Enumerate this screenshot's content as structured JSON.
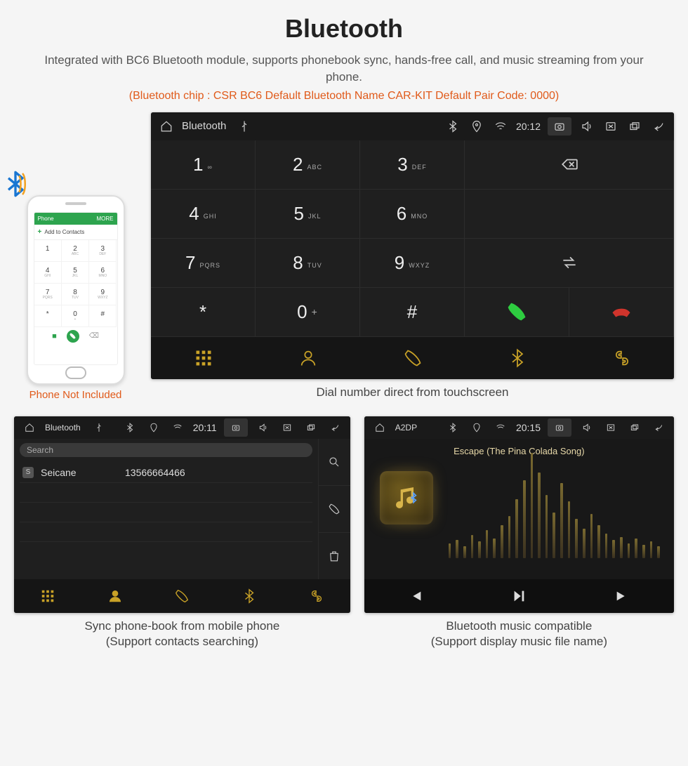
{
  "header": {
    "title": "Bluetooth",
    "description": "Integrated with BC6 Bluetooth module, supports phonebook sync, hands-free call, and music streaming from your phone.",
    "note": "(Bluetooth chip : CSR BC6    Default Bluetooth Name CAR-KIT    Default Pair Code: 0000)"
  },
  "phone_mock": {
    "top_left": "Phone",
    "top_right": "MORE",
    "add_label": "Add to Contacts",
    "keys": [
      {
        "n": "1",
        "s": ""
      },
      {
        "n": "2",
        "s": "ABC"
      },
      {
        "n": "3",
        "s": "DEF"
      },
      {
        "n": "4",
        "s": "GHI"
      },
      {
        "n": "5",
        "s": "JKL"
      },
      {
        "n": "6",
        "s": "MNO"
      },
      {
        "n": "7",
        "s": "PQRS"
      },
      {
        "n": "8",
        "s": "TUV"
      },
      {
        "n": "9",
        "s": "WXYZ"
      },
      {
        "n": "*",
        "s": ""
      },
      {
        "n": "0",
        "s": "+"
      },
      {
        "n": "#",
        "s": ""
      }
    ],
    "caption": "Phone Not Included"
  },
  "dialer": {
    "status": {
      "title": "Bluetooth",
      "time": "20:12"
    },
    "keys": [
      {
        "n": "1",
        "s": "∞"
      },
      {
        "n": "2",
        "s": "ABC"
      },
      {
        "n": "3",
        "s": "DEF"
      },
      {
        "n": "4",
        "s": "GHI"
      },
      {
        "n": "5",
        "s": "JKL"
      },
      {
        "n": "6",
        "s": "MNO"
      },
      {
        "n": "7",
        "s": "PQRS"
      },
      {
        "n": "8",
        "s": "TUV"
      },
      {
        "n": "9",
        "s": "WXYZ"
      },
      {
        "n": "*",
        "s": ""
      },
      {
        "n": "0",
        "s": "+"
      },
      {
        "n": "#",
        "s": ""
      }
    ],
    "caption": "Dial number direct from touchscreen"
  },
  "contacts": {
    "status": {
      "title": "Bluetooth",
      "time": "20:11"
    },
    "search_placeholder": "Search",
    "rows": [
      {
        "initial": "S",
        "name": "Seicane",
        "number": "13566664466"
      }
    ],
    "caption_line1": "Sync phone-book from mobile phone",
    "caption_line2": "(Support contacts searching)"
  },
  "a2dp": {
    "status": {
      "title": "A2DP",
      "time": "20:15"
    },
    "track": "Escape (The Pina Colada Song)",
    "viz_heights": [
      18,
      22,
      14,
      28,
      20,
      34,
      24,
      40,
      52,
      72,
      96,
      130,
      105,
      78,
      56,
      92,
      70,
      48,
      36,
      54,
      40,
      30,
      22,
      26,
      18,
      24,
      16,
      20,
      14
    ],
    "caption_line1": "Bluetooth music compatible",
    "caption_line2": "(Support display music file name)"
  }
}
